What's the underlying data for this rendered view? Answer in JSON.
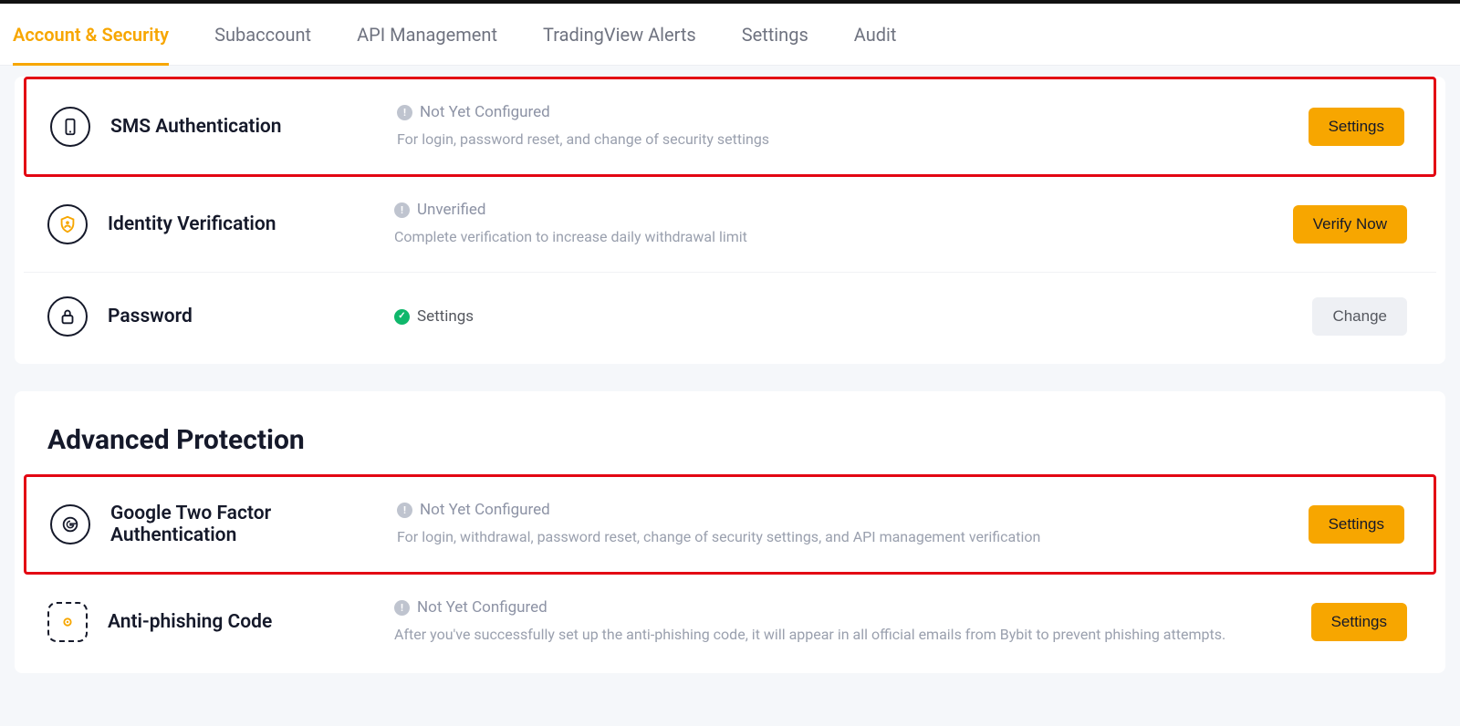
{
  "tabs": [
    {
      "label": "Account & Security",
      "active": true
    },
    {
      "label": "Subaccount",
      "active": false
    },
    {
      "label": "API Management",
      "active": false
    },
    {
      "label": "TradingView Alerts",
      "active": false
    },
    {
      "label": "Settings",
      "active": false
    },
    {
      "label": "Audit",
      "active": false
    }
  ],
  "basic": {
    "rows": {
      "sms": {
        "title": "SMS Authentication",
        "status": "Not Yet Configured",
        "status_ok": false,
        "desc": "For login, password reset, and change of security settings",
        "action": "Settings",
        "action_style": "orange",
        "highlighted": true
      },
      "identity": {
        "title": "Identity Verification",
        "status": "Unverified",
        "status_ok": false,
        "desc": "Complete verification to increase daily withdrawal limit",
        "action": "Verify Now",
        "action_style": "orange",
        "highlighted": false
      },
      "password": {
        "title": "Password",
        "status": "Settings",
        "status_ok": true,
        "desc": "",
        "action": "Change",
        "action_style": "gray",
        "highlighted": false
      }
    }
  },
  "advanced": {
    "heading": "Advanced Protection",
    "rows": {
      "google2fa": {
        "title": "Google Two Factor Authentication",
        "status": "Not Yet Configured",
        "status_ok": false,
        "desc": "For login, withdrawal, password reset, change of security settings, and API management verification",
        "action": "Settings",
        "action_style": "orange",
        "highlighted": true
      },
      "antiphish": {
        "title": "Anti-phishing Code",
        "status": "Not Yet Configured",
        "status_ok": false,
        "desc": "After you've successfully set up the anti-phishing code, it will appear in all official emails from Bybit to prevent phishing attempts.",
        "action": "Settings",
        "action_style": "orange",
        "highlighted": false
      }
    }
  },
  "colors": {
    "accent": "#f7a600",
    "success": "#0fb76b",
    "highlight": "#e30613"
  }
}
